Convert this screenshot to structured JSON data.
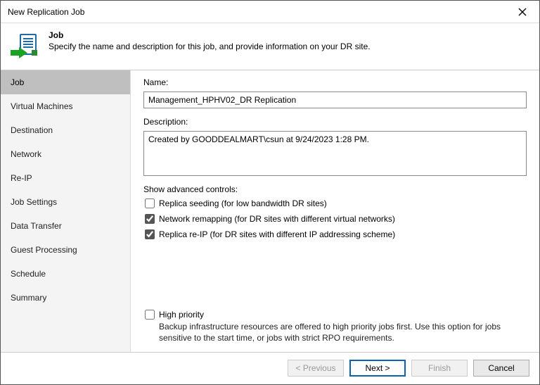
{
  "window": {
    "title": "New Replication Job"
  },
  "header": {
    "heading": "Job",
    "subtitle": "Specify the name and description for this job, and provide information on your DR site."
  },
  "sidebar": {
    "steps": [
      "Job",
      "Virtual Machines",
      "Destination",
      "Network",
      "Re-IP",
      "Job Settings",
      "Data Transfer",
      "Guest Processing",
      "Schedule",
      "Summary"
    ],
    "active_index": 0
  },
  "form": {
    "name_label": "Name:",
    "name_value": "Management_HPHV02_DR Replication",
    "description_label": "Description:",
    "description_value": "Created by GOODDEALMART\\csun at 9/24/2023 1:28 PM.",
    "advanced_label": "Show advanced controls:",
    "options": {
      "seeding": {
        "label": "Replica seeding (for low bandwidth DR sites)",
        "checked": false
      },
      "remap": {
        "label": "Network remapping (for DR sites with different virtual networks)",
        "checked": true
      },
      "reip": {
        "label": "Replica re-IP (for DR sites with different IP addressing scheme)",
        "checked": true
      }
    },
    "high_priority": {
      "label": "High priority",
      "checked": false,
      "description": "Backup infrastructure resources are offered to high priority jobs first. Use this option for jobs sensitive to the start time, or jobs with strict RPO requirements."
    }
  },
  "footer": {
    "previous": "< Previous",
    "next": "Next >",
    "finish": "Finish",
    "cancel": "Cancel"
  }
}
